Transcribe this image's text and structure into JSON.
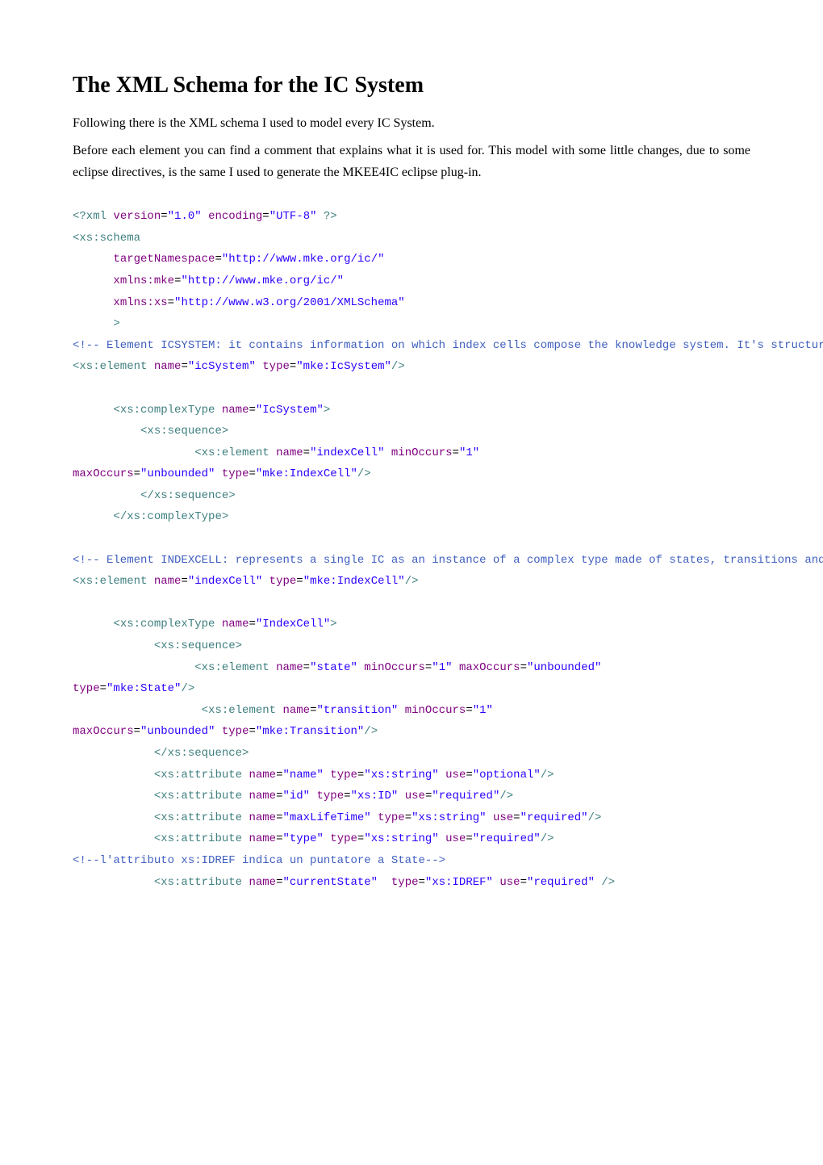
{
  "title": "The XML Schema for the IC System",
  "intro_line1": "Following there is the XML schema I used to model every IC System.",
  "intro_line2": "Before each element you can find a comment that explains what it is used for. This model with some little changes, due to some eclipse directives, is the same I used to generate the MKEE4IC eclipse plug-in.",
  "code": {
    "xml_version": "\"1.0\"",
    "xml_encoding": "\"UTF-8\"",
    "targetNamespace": "\"http://www.mke.org/ic/\"",
    "xmlns_mke": "\"http://www.mke.org/ic/\"",
    "xmlns_xs": "\"http://www.w3.org/2001/XMLSchema\"",
    "comment_icsystem": "<!-- Element ICSYSTEM: it contains information on which index cells compose the knowledge system. It's structured as a sequence of index cells. -->",
    "icSystem_name": "\"icSystem\"",
    "icSystem_type": "\"mke:IcSystem\"",
    "IcSystem_name": "\"IcSystem\"",
    "indexCell_name": "\"indexCell\"",
    "minOccurs_1": "\"1\"",
    "maxOccurs_unbounded": "\"unbounded\"",
    "indexCell_type": "\"mke:IndexCell\"",
    "comment_indexcell": "<!-- Element INDEXCELL: represents a single IC as an instance of a complex type made of states, transitions and some necessary attributes. -->",
    "IndexCell_name": "\"IndexCell\"",
    "state_name": "\"state\"",
    "state_type": "\"mke:State\"",
    "transition_name": "\"transition\"",
    "transition_type": "\"mke:Transition\"",
    "attr_name_name": "\"name\"",
    "xs_string": "\"xs:string\"",
    "use_optional": "\"optional\"",
    "attr_id_name": "\"id\"",
    "xs_ID": "\"xs:ID\"",
    "use_required": "\"required\"",
    "attr_maxLifeTime": "\"maxLifeTime\"",
    "attr_type": "\"type\"",
    "comment_idref": "<!--l'attributo xs:IDREF indica un puntatore a State-->",
    "attr_currentState": "\"currentState\"",
    "xs_IDREF": "\"xs:IDREF\""
  }
}
